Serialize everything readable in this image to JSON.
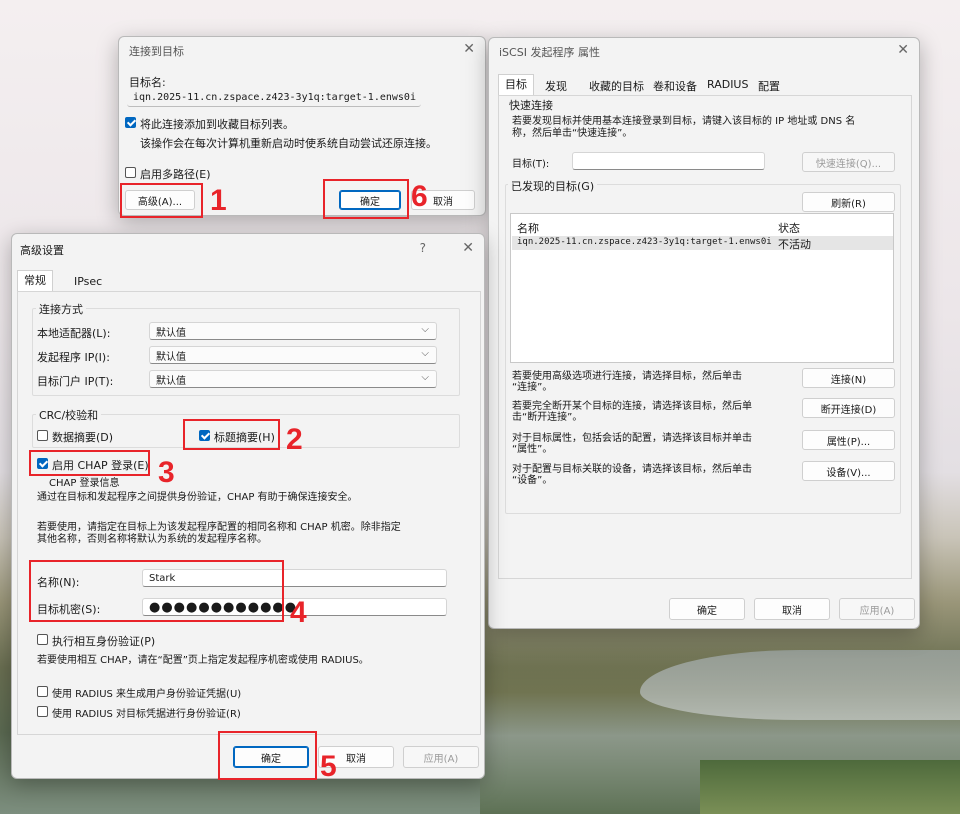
{
  "colors": {
    "accent": "#0067c0",
    "annotation": "#e8242a"
  },
  "connect_dialog": {
    "title": "连接到目标",
    "target_name_label": "目标名:",
    "target_name_value": "iqn.2025-11.cn.zspace.z423-3y1q:target-1.enws0i",
    "add_favorites_label": "将此连接添加到收藏目标列表。",
    "add_favorites_desc": "该操作会在每次计算机重新启动时使系统自动尝试还原连接。",
    "multipath_label": "启用多路径(E)",
    "advanced_button": "高级(A)...",
    "ok_button": "确定",
    "cancel_button": "取消"
  },
  "advanced_dialog": {
    "title": "高级设置",
    "help_icon": "?",
    "tabs": [
      "常规",
      "IPsec"
    ],
    "connect_group": "连接方式",
    "local_adapter_label": "本地适配器(L):",
    "local_adapter_value": "默认值",
    "initiator_ip_label": "发起程序 IP(I):",
    "initiator_ip_value": "默认值",
    "target_portal_label": "目标门户 IP(T):",
    "target_portal_value": "默认值",
    "crc_group": "CRC/校验和",
    "data_digest_label": "数据摘要(D)",
    "header_digest_label": "标题摘要(H)",
    "enable_chap_label": "启用 CHAP 登录(E)",
    "chap_group": "CHAP 登录信息",
    "chap_desc1": "通过在目标和发起程序之间提供身份验证，CHAP 有助于确保连接安全。",
    "chap_desc2": "若要使用，请指定在目标上为该发起程序配置的相同名称和 CHAP 机密。除非指定",
    "chap_desc3": "其他名称，否则名称将默认为系统的发起程序名称。",
    "name_label": "名称(N):",
    "name_value": "Stark",
    "secret_label": "目标机密(S):",
    "secret_value": "●●●●●●●●●●●●",
    "mutual_auth_label": "执行相互身份验证(P)",
    "mutual_auth_desc": "若要使用相互 CHAP，请在“配置”页上指定发起程序机密或使用 RADIUS。",
    "radius_user_label": "使用 RADIUS 来生成用户身份验证凭据(U)",
    "radius_target_label": "使用 RADIUS 对目标凭据进行身份验证(R)",
    "ok_button": "确定",
    "cancel_button": "取消",
    "apply_button": "应用(A)"
  },
  "iscsi_dialog": {
    "title": "iSCSI 发起程序 属性",
    "tabs": [
      "目标",
      "发现",
      "收藏的目标",
      "卷和设备",
      "RADIUS",
      "配置"
    ],
    "quick_connect_group": "快速连接",
    "quick_connect_desc1": "若要发现目标并使用基本连接登录到目标，请键入该目标的 IP 地址或 DNS 名",
    "quick_connect_desc2": "称，然后单击“快速连接”。",
    "target_label": "目标(T):",
    "quick_connect_button": "快速连接(Q)...",
    "discovered_group": "已发现的目标(G)",
    "refresh_button": "刷新(R)",
    "list_headers": [
      "名称",
      "状态"
    ],
    "list_rows": [
      {
        "name": "iqn.2025-11.cn.zspace.z423-3y1q:target-1.enws0i",
        "status": "不活动"
      }
    ],
    "connect_desc1": "若要使用高级选项进行连接，请选择目标，然后单击",
    "connect_desc2": "“连接”。",
    "connect_button": "连接(N)",
    "disconnect_desc1": "若要完全断开某个目标的连接，请选择该目标，然后单",
    "disconnect_desc2": "击“断开连接”。",
    "disconnect_button": "断开连接(D)",
    "properties_desc1": "对于目标属性，包括会话的配置，请选择该目标并单击",
    "properties_desc2": "“属性”。",
    "properties_button": "属性(P)...",
    "devices_desc1": "对于配置与目标关联的设备，请选择该目标，然后单击",
    "devices_desc2": "“设备”。",
    "devices_button": "设备(V)...",
    "ok_button": "确定",
    "cancel_button": "取消",
    "apply_button": "应用(A)"
  },
  "annotations": [
    "1",
    "2",
    "3",
    "4",
    "5",
    "6"
  ]
}
